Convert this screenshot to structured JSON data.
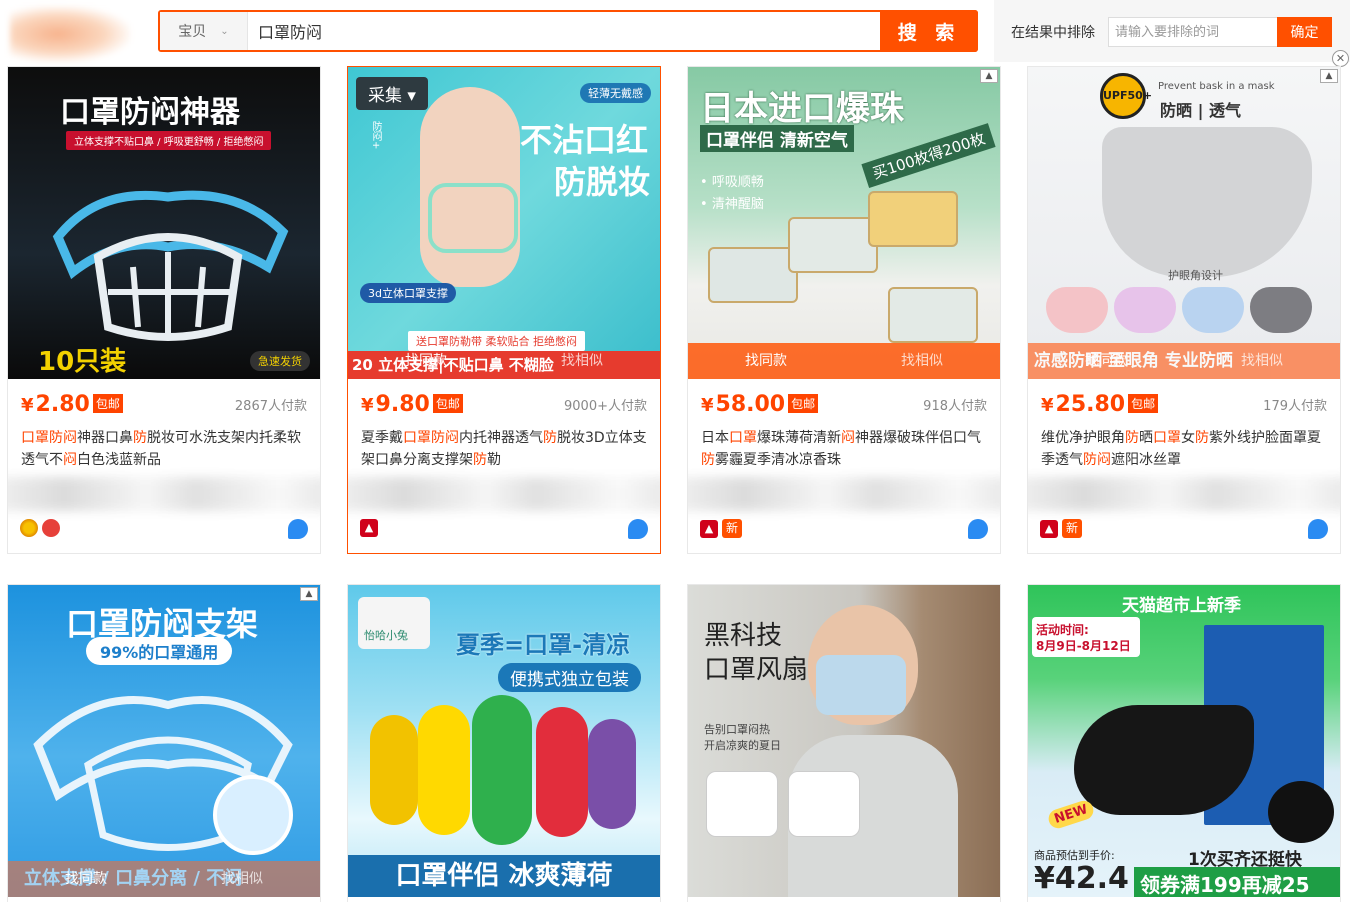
{
  "search": {
    "scope_label": "宝贝",
    "query": "口罩防闷",
    "button_label": "搜 索"
  },
  "exclude": {
    "label": "在结果中排除",
    "placeholder": "请输入要排除的词",
    "confirm_label": "确定"
  },
  "colors": {
    "accent": "#ff5000",
    "price": "#ff4400",
    "highlight": "#ff4400"
  },
  "products": [
    {
      "image_headline": "口罩防闷神器",
      "image_sub": "立体支撑不贴口鼻 / 呼吸更舒畅 / 拒绝憋闷",
      "image_corner_left": "10只装",
      "image_corner_right": "急速发货",
      "price": "2.80",
      "currency": "¥",
      "free_shipping": "包邮",
      "sales": "2867人付款",
      "title_parts": [
        "口罩",
        "防闷",
        "神器口鼻",
        "防",
        "脱妆可水洗支架内托柔软透气不",
        "闷",
        "白色浅蓝新品"
      ]
    },
    {
      "image_headline": "不沾口红",
      "image_headline2": "防脱妆",
      "image_tag_top": "轻薄无戴感",
      "image_collect": "采集",
      "image_side": "防闷+",
      "image_sub": "送口罩防勒带 柔软贴合 拒绝憋闷",
      "image_badge": "3d立体口罩支撑",
      "image_bottom": "20 立体支撑|不贴口鼻 不糊脸",
      "find_same": "找同款",
      "find_similar": "找相似",
      "price": "9.80",
      "currency": "¥",
      "free_shipping": "包邮",
      "sales": "9000+人付款",
      "title_parts": [
        "夏季戴",
        "口罩",
        "防闷",
        "内托神器透气",
        "防",
        "脱妆3D立体支架口鼻分离支撑架",
        "防",
        "勒"
      ]
    },
    {
      "image_headline": "日本进口爆珠",
      "image_sub": "口罩伴侣 清新空气",
      "image_bullets": [
        "呼吸顺畅",
        "清神醒脑"
      ],
      "image_ribbon": "买100枚得200枚",
      "find_same": "找同款",
      "find_similar": "找相似",
      "price": "58.00",
      "currency": "¥",
      "free_shipping": "包邮",
      "sales": "918人付款",
      "title_parts": [
        "日本",
        "口罩",
        "爆珠薄荷清新",
        "闷",
        "神器爆破珠伴侣口气",
        "防",
        "雾霾夏季清冰凉香珠"
      ]
    },
    {
      "image_en": "Prevent bask in a mask",
      "image_headline": "防晒 | 透气",
      "image_upf": "UPF50+",
      "image_note": "护眼角设计",
      "image_bottom": "凉感防晒 至眼角 专业防晒",
      "find_same": "找同款",
      "find_similar": "找相似",
      "price": "25.80",
      "currency": "¥",
      "free_shipping": "包邮",
      "sales": "179人付款",
      "title_parts": [
        "维优净护眼角",
        "防",
        "晒",
        "口罩",
        "女",
        "防",
        "紫外线护脸面罩夏季透气",
        "防闷",
        "遮阳冰丝罩"
      ]
    },
    {
      "image_headline": "口罩防闷支架",
      "image_sub": "99%的口罩通用",
      "image_bottom": "立体支撑 / 口鼻分离 / 不闷",
      "find_same": "找同款",
      "find_similar": "找相似"
    },
    {
      "image_brand": "怡哈小兔",
      "image_headline": "夏季=口罩-清凉",
      "image_sub": "便携式独立包装",
      "image_bottom": "口罩伴侣 冰爽薄荷"
    },
    {
      "image_headline": "黑科技",
      "image_headline2": "口罩风扇",
      "image_sub": "告别口罩闷热",
      "image_sub2": "开启凉爽的夏日"
    },
    {
      "image_top": "天猫超市上新季",
      "image_date_label": "活动时间:",
      "image_date": "8月9日-8月12日",
      "image_new": "NEW",
      "image_price_label": "商品预估到手价:",
      "image_price": "¥42.4",
      "image_promo1": "1次买齐还挺快",
      "image_promo2": "领券满199再减25"
    }
  ]
}
